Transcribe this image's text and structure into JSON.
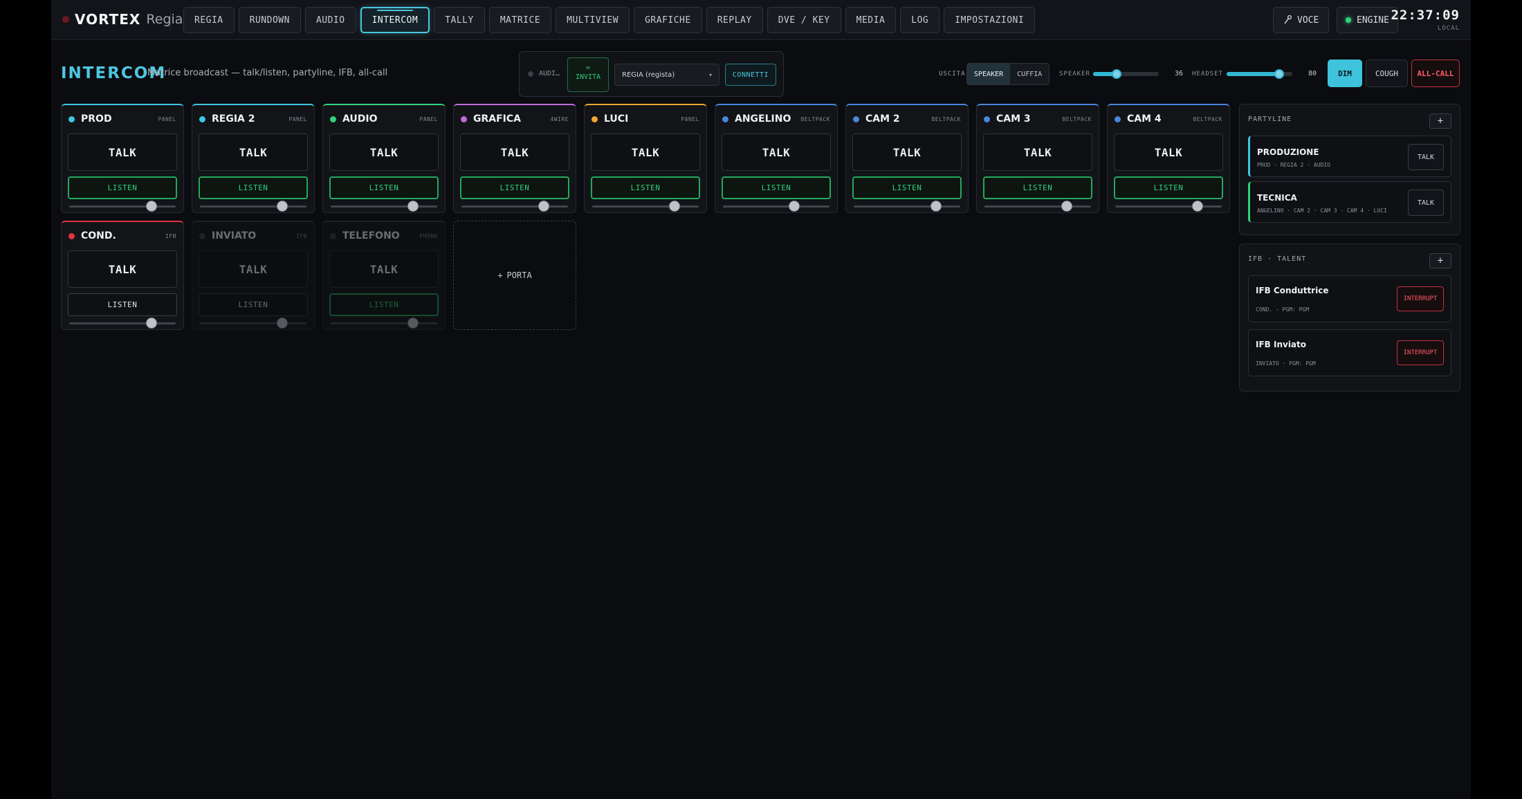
{
  "brand": {
    "name": "VORTEX",
    "sub": "Regia"
  },
  "nav": [
    "REGIA",
    "RUNDOWN",
    "AUDIO",
    "INTERCOM",
    "TALLY",
    "MATRICE",
    "MULTIVIEW",
    "GRAFICHE",
    "REPLAY",
    "DVE / KEY",
    "MEDIA",
    "LOG",
    "IMPOSTAZIONI"
  ],
  "nav_active": "INTERCOM",
  "voce": {
    "label": "VOCE",
    "icon": "microphone-icon"
  },
  "engine": {
    "label": "ENGINE",
    "status_color": "#2fd27a"
  },
  "clock": {
    "time": "22:37:09",
    "zone": "LOCAL"
  },
  "page": {
    "title": "INTERCOM",
    "subtitle": "Matrice broadcast — talk/listen, partyline, IFB, all-call"
  },
  "invite": {
    "status": "AUDI…",
    "button": "INVITA",
    "icon": "chat-icon",
    "destination": "REGIA (regista)",
    "connect": "CONNETTI"
  },
  "output": {
    "label": "USCITA",
    "options": [
      "SPEAKER",
      "CUFFIA"
    ],
    "selected": "SPEAKER",
    "speaker_label": "SPEAKER",
    "speaker_value": 36,
    "headset_label": "HEADSET",
    "headset_value": 80
  },
  "actions": {
    "dim": "DIM",
    "cough": "COUGH",
    "allcall": "ALL-CALL"
  },
  "ports": [
    {
      "name": "PROD",
      "type": "PANEL",
      "color": "#3ec6e4",
      "talk": "TALK",
      "listen": "LISTEN",
      "listen_on": true,
      "level": 0.77,
      "enabled": true
    },
    {
      "name": "REGIA 2",
      "type": "PANEL",
      "color": "#3ec6e4",
      "talk": "TALK",
      "listen": "LISTEN",
      "listen_on": true,
      "level": 0.77,
      "enabled": true
    },
    {
      "name": "AUDIO",
      "type": "PANEL",
      "color": "#2fd27a",
      "talk": "TALK",
      "listen": "LISTEN",
      "listen_on": true,
      "level": 0.77,
      "enabled": true
    },
    {
      "name": "GRAFICA",
      "type": "4WIRE",
      "color": "#c36bdc",
      "talk": "TALK",
      "listen": "LISTEN",
      "listen_on": true,
      "level": 0.77,
      "enabled": true
    },
    {
      "name": "LUCI",
      "type": "PANEL",
      "color": "#f0a631",
      "talk": "TALK",
      "listen": "LISTEN",
      "listen_on": true,
      "level": 0.77,
      "enabled": true
    },
    {
      "name": "ANGELINO",
      "type": "BELTPACK",
      "color": "#4a86dc",
      "talk": "TALK",
      "listen": "LISTEN",
      "listen_on": true,
      "level": 0.67,
      "enabled": true
    },
    {
      "name": "CAM 2",
      "type": "BELTPACK",
      "color": "#4a86dc",
      "talk": "TALK",
      "listen": "LISTEN",
      "listen_on": true,
      "level": 0.77,
      "enabled": true
    },
    {
      "name": "CAM 3",
      "type": "BELTPACK",
      "color": "#4a86dc",
      "talk": "TALK",
      "listen": "LISTEN",
      "listen_on": true,
      "level": 0.77,
      "enabled": true
    },
    {
      "name": "CAM 4",
      "type": "BELTPACK",
      "color": "#4a86dc",
      "talk": "TALK",
      "listen": "LISTEN",
      "listen_on": true,
      "level": 0.77,
      "enabled": true
    },
    {
      "name": "COND.",
      "type": "IFB",
      "color": "#e5323f",
      "talk": "TALK",
      "listen": "LISTEN",
      "listen_on": false,
      "level": 0.77,
      "enabled": true
    },
    {
      "name": "INVIATO",
      "type": "IFB",
      "color": "#3a3e45",
      "talk": "TALK",
      "listen": "LISTEN",
      "listen_on": false,
      "level": 0.77,
      "enabled": false
    },
    {
      "name": "TELEFONO",
      "type": "PHONE",
      "color": "#3a3e45",
      "talk": "TALK",
      "listen": "LISTEN",
      "listen_on": true,
      "level": 0.77,
      "enabled": false
    }
  ],
  "add_port": "PORTA",
  "partyline": {
    "title": "PARTYLINE",
    "items": [
      {
        "name": "PRODUZIONE",
        "members": "PROD · REGIA 2 · AUDIO",
        "talk": "TALK",
        "color": "#3ec6e4"
      },
      {
        "name": "TECNICA",
        "members": "ANGELINO · CAM 2 · CAM 3 · CAM 4 · LUCI",
        "talk": "TALK",
        "color": "#2fd27a"
      }
    ]
  },
  "ifb": {
    "title": "IFB · TALENT",
    "items": [
      {
        "name": "IFB Conduttrice",
        "sub": "COND. · PGM: PGM",
        "button": "INTERRUPT"
      },
      {
        "name": "IFB Inviato",
        "sub": "INVIATO · PGM: PGM",
        "button": "INTERRUPT"
      }
    ]
  }
}
